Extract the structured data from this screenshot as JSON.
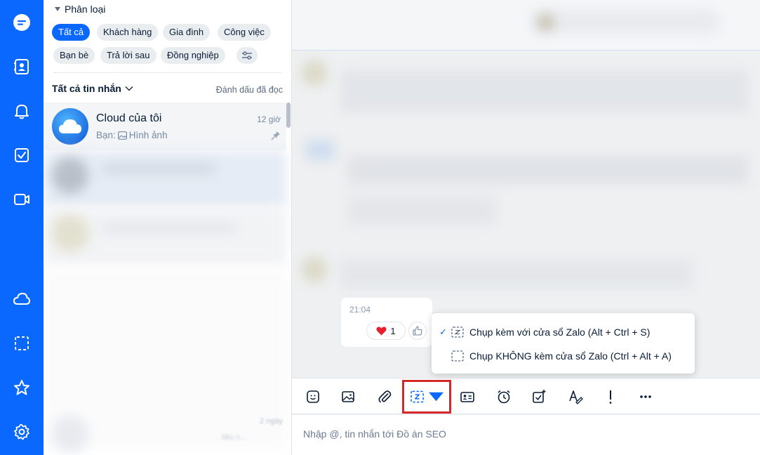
{
  "app": {
    "accent": "#0a68ff"
  },
  "rail": {
    "items": [
      {
        "icon": "chat-icon",
        "active": true
      },
      {
        "icon": "contacts-icon"
      },
      {
        "icon": "bell-icon"
      },
      {
        "icon": "todo-icon"
      },
      {
        "icon": "video-icon"
      },
      {
        "icon": "cloud-icon"
      },
      {
        "icon": "screenshot-icon"
      },
      {
        "icon": "star-icon"
      },
      {
        "icon": "settings-icon"
      }
    ]
  },
  "categories": {
    "heading": "Phân loại",
    "chips": [
      "Tất cả",
      "Khách hàng",
      "Gia đình",
      "Công việc",
      "Bạn bè",
      "Trả lời sau",
      "Đồng nghiệp"
    ],
    "active": "Tất cả"
  },
  "list_header": {
    "filter_label": "Tất cả tin nhắn",
    "mark_read": "Đánh dấu đã đọc"
  },
  "conversations": [
    {
      "name": "Cloud của tôi",
      "preview_prefix": "Bạn:",
      "preview": "Hình ảnh",
      "time": "12 giờ",
      "pinned": true
    }
  ],
  "blurred_conversation": {
    "time": "2 ngày",
    "preview": "liệu n..."
  },
  "chat": {
    "message_time": "21:04",
    "reaction_count": "1"
  },
  "capture_menu": {
    "items": [
      {
        "label": "Chụp kèm với cửa sổ Zalo (Alt + Ctrl + S)",
        "checked": true
      },
      {
        "label": "Chụp KHÔNG kèm cửa sổ Zalo (Ctrl + Alt + A)",
        "checked": false
      }
    ]
  },
  "toolbar": {
    "items": [
      "sticker-icon",
      "image-icon",
      "attachment-icon",
      "screenshot-capture-icon",
      "contact-card-icon",
      "reminder-icon",
      "task-icon",
      "text-format-icon",
      "urgent-icon",
      "more-icon"
    ]
  },
  "composer": {
    "placeholder": "Nhập @, tin nhắn tới Đồ án SEO"
  }
}
